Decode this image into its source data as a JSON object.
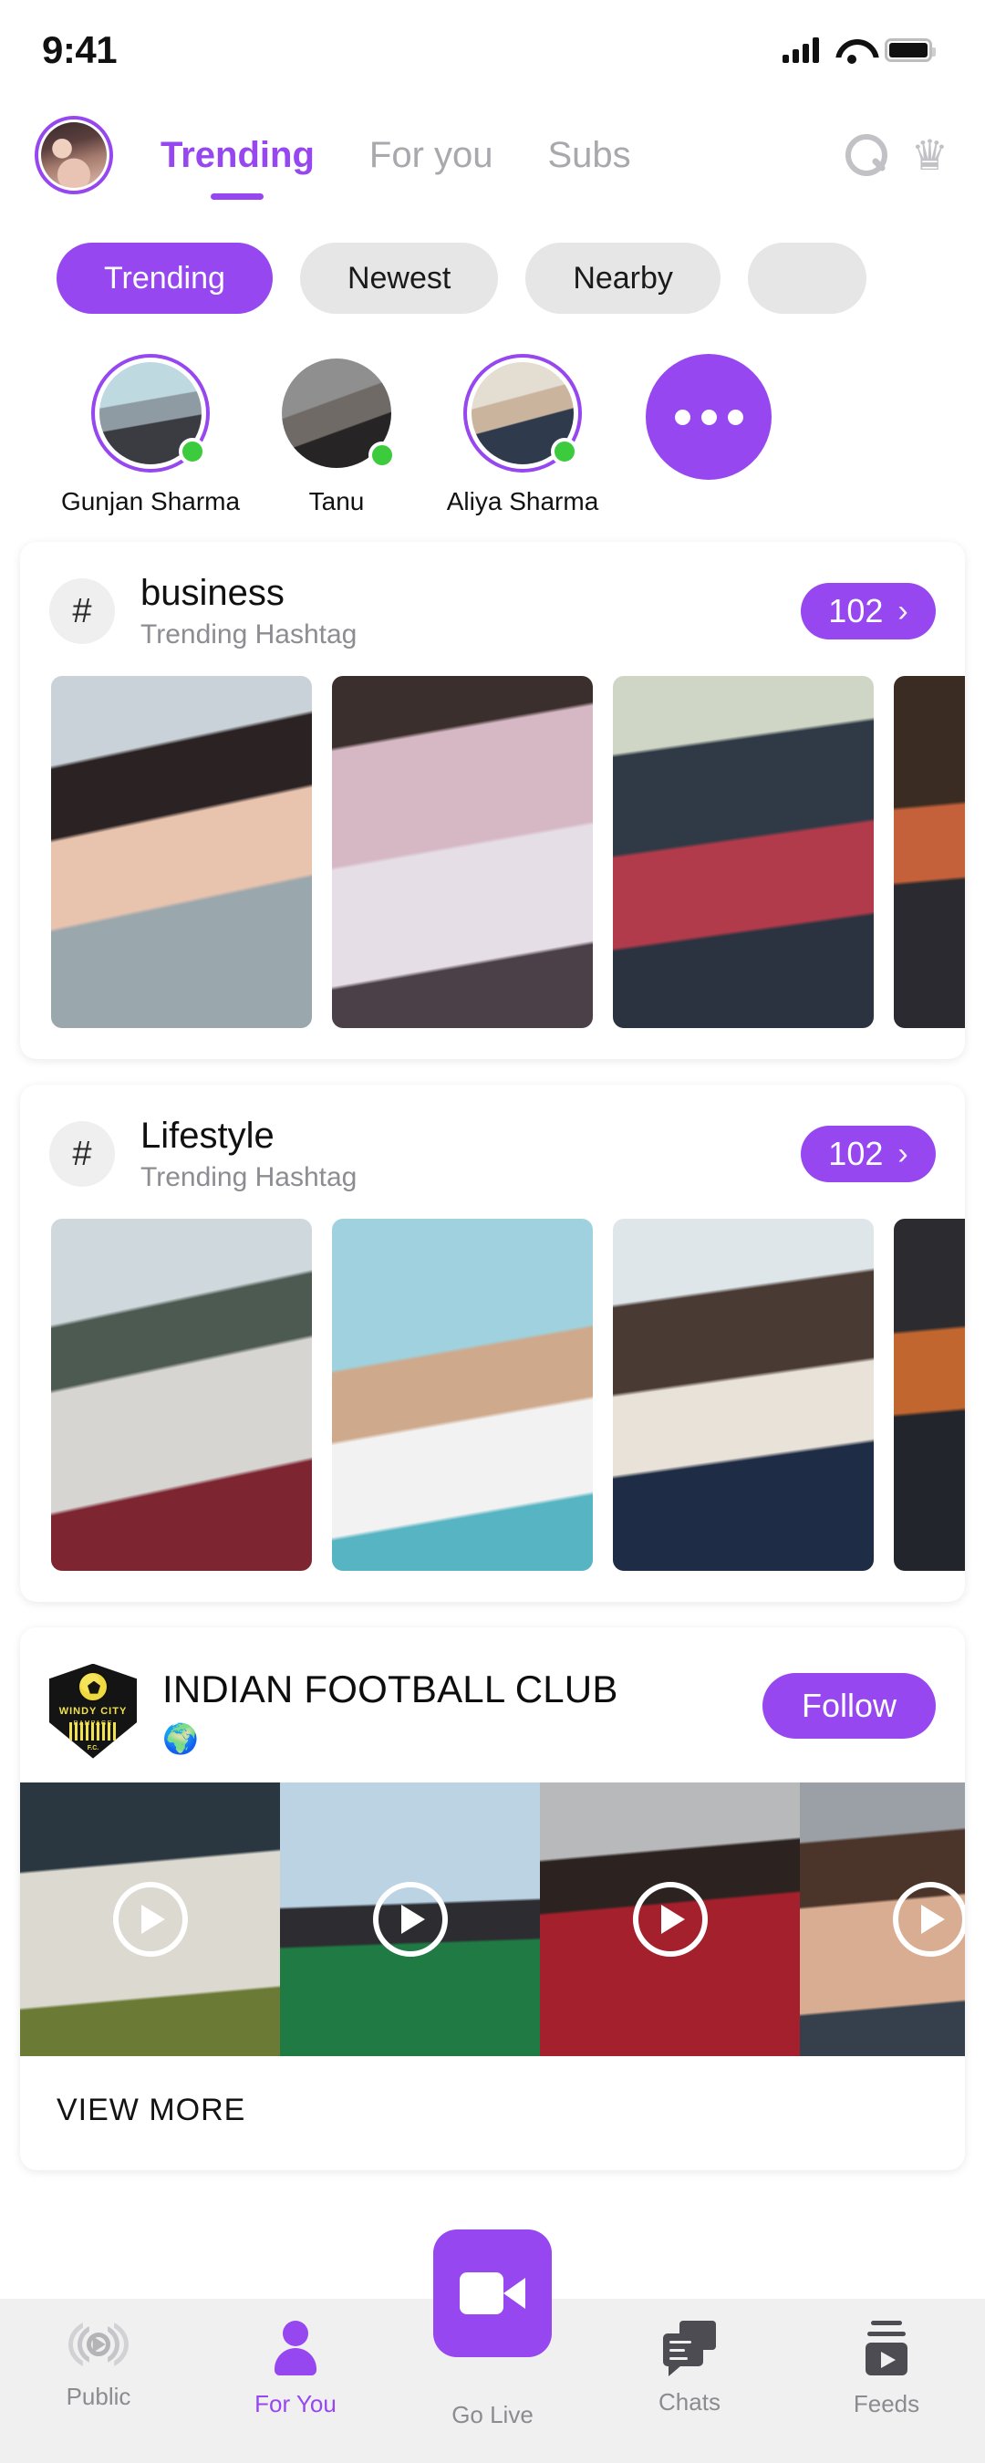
{
  "status_bar": {
    "time": "9:41",
    "signal_icon": "signal-bars-icon",
    "wifi_icon": "wifi-icon",
    "battery_icon": "battery-full-icon"
  },
  "header": {
    "avatar_name": "profile-avatar",
    "tabs": [
      {
        "label": "Trending",
        "active": true
      },
      {
        "label": "For you",
        "active": false
      },
      {
        "label": "Subs",
        "active": false
      }
    ],
    "search_icon": "search-icon",
    "premium_icon": "crown-icon"
  },
  "filter_chips": [
    {
      "label": "Trending",
      "active": true
    },
    {
      "label": "Newest",
      "active": false
    },
    {
      "label": "Nearby",
      "active": false
    },
    {
      "label": "",
      "active": false
    }
  ],
  "stories": {
    "items": [
      {
        "name": "Gunjan Sharma",
        "online": true,
        "has_ring": true
      },
      {
        "name": "Tanu",
        "online": true,
        "has_ring": false
      },
      {
        "name": "Aliya Sharma",
        "online": true,
        "has_ring": true
      }
    ],
    "more_label": "more-stories-button"
  },
  "hashtag_cards": [
    {
      "hash_symbol": "#",
      "name": "business",
      "subtitle": "Trending Hashtag",
      "count": "102",
      "chevron": "›",
      "thumbnails": [
        "thumb-1",
        "thumb-2",
        "thumb-3",
        "thumb-4"
      ]
    },
    {
      "hash_symbol": "#",
      "name": "Lifestyle",
      "subtitle": "Trending Hashtag",
      "count": "102",
      "chevron": "›",
      "thumbnails": [
        "thumb-1",
        "thumb-2",
        "thumb-3",
        "thumb-4"
      ]
    }
  ],
  "channel_card": {
    "logo_text_top": "WINDY CITY",
    "logo_text_mid": "RAMPAGE",
    "logo_text_bottom": "F.C.",
    "name": "INDIAN FOOTBALL CLUB",
    "globe_icon": "🌍",
    "follow_label": "Follow",
    "videos": [
      "video-1",
      "video-2",
      "video-3",
      "video-4"
    ],
    "view_more_label": "VIEW MORE"
  },
  "bottom_nav": {
    "items": [
      {
        "label": "Public",
        "icon": "broadcast-icon",
        "active": false
      },
      {
        "label": "For You",
        "icon": "person-icon",
        "active": true
      },
      {
        "label": "Go Live",
        "icon": "video-camera-icon",
        "active": false
      },
      {
        "label": "Chats",
        "icon": "chat-bubbles-icon",
        "active": false
      },
      {
        "label": "Feeds",
        "icon": "feeds-icon",
        "active": false
      }
    ]
  },
  "colors": {
    "accent_purple": "#9747f0",
    "chip_gray": "#e6e6e6",
    "nav_bg": "#f0f0f0",
    "online_green": "#3ccb3c"
  }
}
